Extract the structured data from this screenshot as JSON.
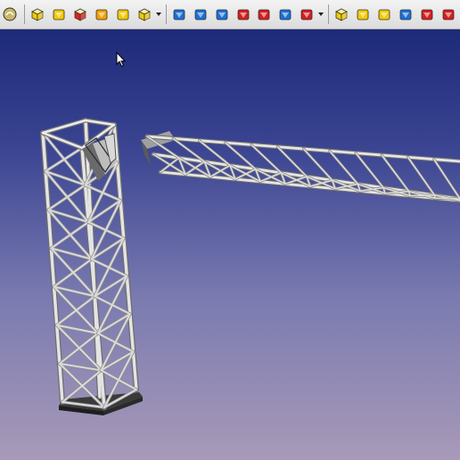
{
  "toolbar": {
    "buttons": [
      {
        "name": "part-design-icon",
        "color": "#c8b86a"
      },
      {
        "name": "separator"
      },
      {
        "name": "box-icon",
        "color": "#f2c900"
      },
      {
        "name": "wedge-icon",
        "color": "#f2c900"
      },
      {
        "name": "cube-red-icon",
        "color": "#e02020"
      },
      {
        "name": "chamfer-icon",
        "color": "#f2a000"
      },
      {
        "name": "revolve-icon",
        "color": "#f2c900"
      },
      {
        "name": "pad-icon",
        "color": "#f2c900"
      },
      {
        "name": "dropdown"
      },
      {
        "name": "separator"
      },
      {
        "name": "shape-blue-icon",
        "color": "#1a6fd6"
      },
      {
        "name": "pocket-icon",
        "color": "#1a6fd6"
      },
      {
        "name": "groove-icon",
        "color": "#1a6fd6"
      },
      {
        "name": "subtract-red-icon",
        "color": "#d81c1c"
      },
      {
        "name": "fillet-icon",
        "color": "#d81c1c"
      },
      {
        "name": "mirror-icon",
        "color": "#1a6fd6"
      },
      {
        "name": "pattern-icon",
        "color": "#d81c1c"
      },
      {
        "name": "dropdown"
      },
      {
        "name": "separator"
      },
      {
        "name": "boolean-union-icon",
        "color": "#f2c900"
      },
      {
        "name": "multi-transform-icon",
        "color": "#f2c900"
      },
      {
        "name": "linear-pattern-icon",
        "color": "#f2c900"
      },
      {
        "name": "polar-pattern-icon",
        "color": "#1a6fd6"
      },
      {
        "name": "thickness-icon",
        "color": "#d81c1c"
      },
      {
        "name": "draft-icon",
        "color": "#d81c1c"
      }
    ]
  },
  "viewport": {
    "background_top": "#1d2a79",
    "background_bottom": "#a89ab8",
    "model_color": "#cfcfcf"
  }
}
